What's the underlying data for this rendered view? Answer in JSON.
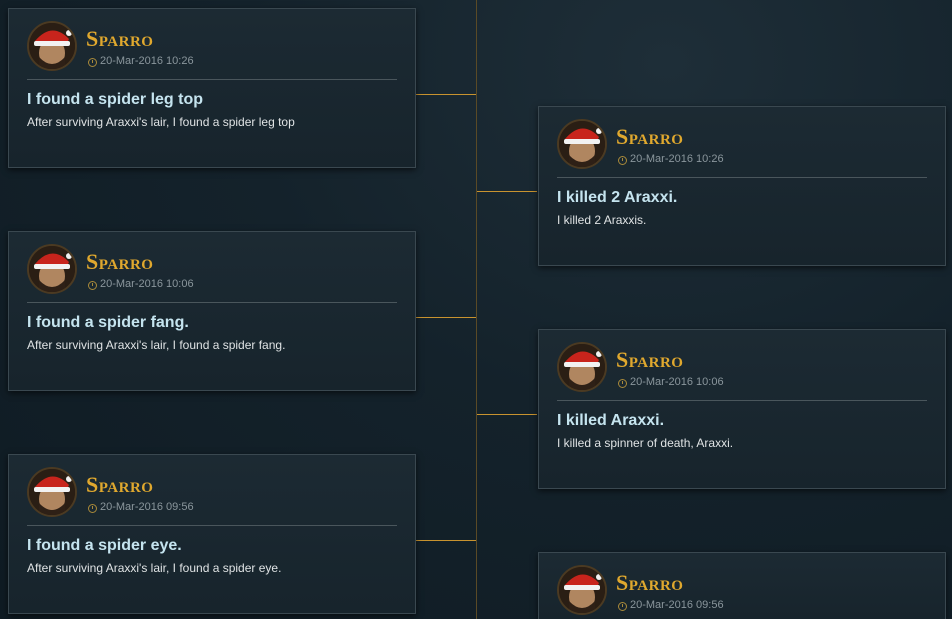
{
  "colors": {
    "name": "#e0a82e",
    "connector": "#c8932f",
    "title": "#c5e4ef"
  },
  "posts": [
    {
      "author": "Sparro",
      "datetime": "20-Mar-2016 10:26",
      "title": "I found a spider leg top",
      "body": "After surviving Araxxi's lair, I found a spider leg top",
      "avatar_icon": "player-avatar-santa-hat"
    },
    {
      "author": "Sparro",
      "datetime": "20-Mar-2016 10:26",
      "title": "I killed 2 Araxxi.",
      "body": "I killed 2 Araxxis.",
      "avatar_icon": "player-avatar-santa-hat"
    },
    {
      "author": "Sparro",
      "datetime": "20-Mar-2016 10:06",
      "title": "I found a spider fang.",
      "body": "After surviving Araxxi's lair, I found a spider fang.",
      "avatar_icon": "player-avatar-santa-hat"
    },
    {
      "author": "Sparro",
      "datetime": "20-Mar-2016 10:06",
      "title": "I killed Araxxi.",
      "body": "I killed a spinner of death, Araxxi.",
      "avatar_icon": "player-avatar-santa-hat"
    },
    {
      "author": "Sparro",
      "datetime": "20-Mar-2016 09:56",
      "title": "I found a spider eye.",
      "body": "After surviving Araxxi's lair, I found a spider eye.",
      "avatar_icon": "player-avatar-santa-hat"
    },
    {
      "author": "Sparro",
      "datetime": "20-Mar-2016 09:56",
      "title": "",
      "body": "",
      "avatar_icon": "player-avatar-santa-hat"
    }
  ]
}
